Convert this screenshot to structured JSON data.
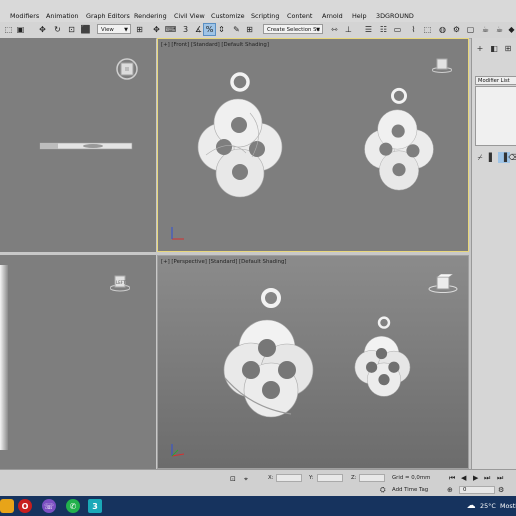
{
  "menubar": {
    "items": [
      "Modifiers",
      "Animation",
      "Graph Editors",
      "Rendering",
      "Civil View",
      "Customize",
      "Scripting",
      "Content",
      "Arnold",
      "Help",
      "3DGROUND"
    ]
  },
  "toolbar": {
    "view_dropdown": "View",
    "selection_set": "Create Selection Se"
  },
  "viewports": {
    "front_label": "[+] [Front] [Standard] [Default Shading]",
    "perspective_label": "[+] [Perspective] [Standard] [Default Shading]",
    "left_cube_label": "LEFT",
    "active_border_color": "#e8d77a"
  },
  "command_panel": {
    "modifier_list": "Modifier List"
  },
  "statusbar": {
    "x_label": "X:",
    "y_label": "Y:",
    "z_label": "Z:",
    "grid": "Grid = 0,0mm",
    "add_time_tag": "Add Time Tag",
    "frame": "0"
  },
  "taskbar": {
    "temperature": "25°C",
    "weather": "Mostl",
    "app_badge": "3"
  }
}
